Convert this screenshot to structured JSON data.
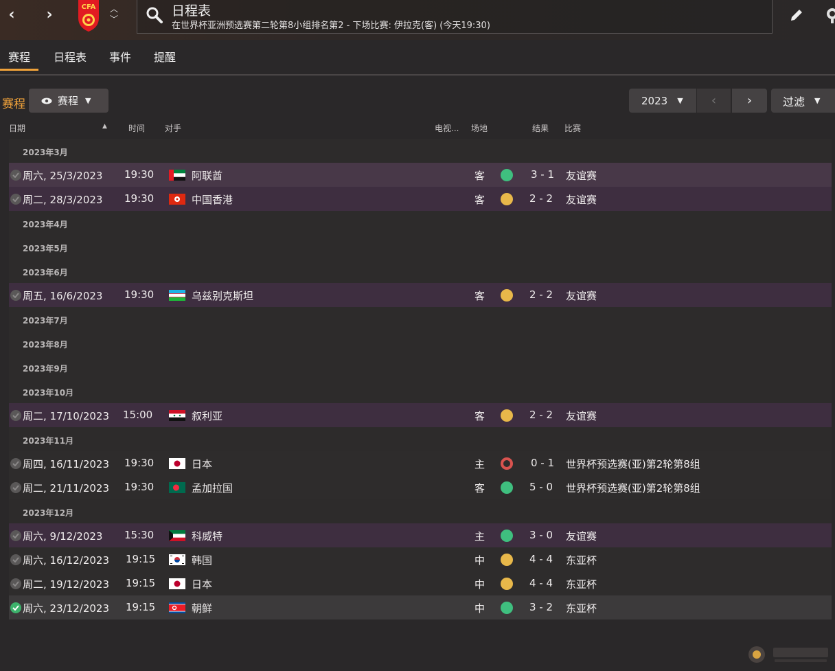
{
  "header": {
    "title": "日程表",
    "subtitle": "在世界杯亚洲预选赛第二轮第8小组排名第2 - 下场比赛: 伊拉克(客) (今天19:30)",
    "crest_text": "CFA",
    "crest_color": "#e11b22"
  },
  "tabs": [
    {
      "label": "赛程"
    },
    {
      "label": "日程表"
    },
    {
      "label": "事件"
    },
    {
      "label": "提醒"
    }
  ],
  "toolbar": {
    "section_label": "赛程",
    "view_label": "赛程",
    "year_label": "2023",
    "filter_label": "过滤"
  },
  "columns": {
    "date": "日期",
    "time": "时间",
    "opponent": "对手",
    "tv": "电视...",
    "venue": "场地",
    "result": "结果",
    "competition": "比赛"
  },
  "months": {
    "m3": "2023年3月",
    "m4": "2023年4月",
    "m5": "2023年5月",
    "m6": "2023年6月",
    "m7": "2023年7月",
    "m8": "2023年8月",
    "m9": "2023年9月",
    "m10": "2023年10月",
    "m11": "2023年11月",
    "m12": "2023年12月"
  },
  "matches": [
    {
      "date": "周六, 25/3/2023",
      "time": "19:30",
      "opponent": "阿联酋",
      "venue": "客",
      "result": "3 - 1",
      "competition": "友谊赛",
      "outcome": "win"
    },
    {
      "date": "周二, 28/3/2023",
      "time": "19:30",
      "opponent": "中国香港",
      "venue": "客",
      "result": "2 - 2",
      "competition": "友谊赛",
      "outcome": "draw"
    },
    {
      "date": "周五, 16/6/2023",
      "time": "19:30",
      "opponent": "乌兹别克斯坦",
      "venue": "客",
      "result": "2 - 2",
      "competition": "友谊赛",
      "outcome": "draw"
    },
    {
      "date": "周二, 17/10/2023",
      "time": "15:00",
      "opponent": "叙利亚",
      "venue": "客",
      "result": "2 - 2",
      "competition": "友谊赛",
      "outcome": "draw"
    },
    {
      "date": "周四, 16/11/2023",
      "time": "19:30",
      "opponent": "日本",
      "venue": "主",
      "result": "0 - 1",
      "competition": "世界杯预选赛(亚)第2轮第8组",
      "outcome": "loss"
    },
    {
      "date": "周二, 21/11/2023",
      "time": "19:30",
      "opponent": "孟加拉国",
      "venue": "客",
      "result": "5 - 0",
      "competition": "世界杯预选赛(亚)第2轮第8组",
      "outcome": "win"
    },
    {
      "date": "周六, 9/12/2023",
      "time": "15:30",
      "opponent": "科威特",
      "venue": "主",
      "result": "3 - 0",
      "competition": "友谊赛",
      "outcome": "win"
    },
    {
      "date": "周六, 16/12/2023",
      "time": "19:15",
      "opponent": "韩国",
      "venue": "中",
      "result": "4 - 4",
      "competition": "东亚杯",
      "outcome": "draw"
    },
    {
      "date": "周二, 19/12/2023",
      "time": "19:15",
      "opponent": "日本",
      "venue": "中",
      "result": "4 - 4",
      "competition": "东亚杯",
      "outcome": "draw"
    },
    {
      "date": "周六, 23/12/2023",
      "time": "19:15",
      "opponent": "朝鲜",
      "venue": "中",
      "result": "3 - 2",
      "competition": "东亚杯",
      "outcome": "win"
    }
  ],
  "colors": {
    "accent": "#f0a23a",
    "win": "#3fbf7f",
    "draw": "#e8b84a",
    "loss": "#d9534f"
  }
}
